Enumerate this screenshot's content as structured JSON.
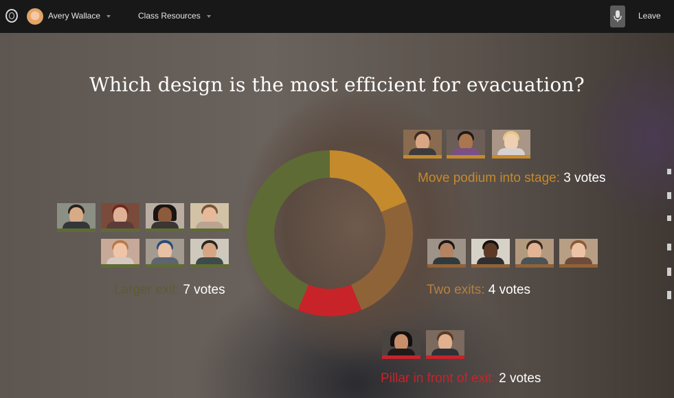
{
  "topbar": {
    "user_name": "Avery Wallace",
    "class_menu": "Class Resources",
    "leave_label": "Leave",
    "icons": [
      "logo-icon",
      "avatar",
      "microphone-icon"
    ]
  },
  "poll": {
    "question": "Which design is the most efficient for evacuation?",
    "options": [
      {
        "label": "Larger exit:",
        "count": "7 votes",
        "votes": 7,
        "color": "#5f6b35",
        "bar": "#5f6b35"
      },
      {
        "label": "Move podium into stage:",
        "count": "3 votes",
        "votes": 3,
        "color": "#c48a2c",
        "bar": "#c48a2c"
      },
      {
        "label": "Two exits:",
        "count": "4 votes",
        "votes": 4,
        "color": "#8f6338",
        "bar": "#8f6338"
      },
      {
        "label": "Pillar in front of exit:",
        "count": "2 votes",
        "votes": 2,
        "color": "#c9232a",
        "bar": "#c9232a"
      }
    ]
  },
  "chart_data": {
    "type": "pie",
    "categories": [
      "Move podium into stage",
      "Two exits",
      "Pillar in front of exit",
      "Larger exit"
    ],
    "values": [
      3,
      4,
      2,
      7
    ],
    "colors": [
      "#c48a2c",
      "#8f6338",
      "#c9232a",
      "#5f6b35"
    ]
  }
}
